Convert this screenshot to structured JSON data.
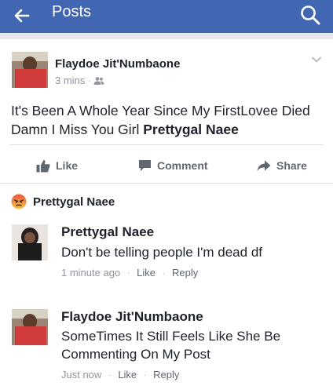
{
  "header": {
    "title": "Posts",
    "back_icon": "arrow-left-icon",
    "search_icon": "search-icon",
    "bar_color": "#4267b2"
  },
  "post": {
    "author": "Flaydoe Jit'Numbaone",
    "time": "3 mins",
    "dot": "·",
    "audience_icon": "friends-icon",
    "menu_icon": "chevron-down-icon",
    "text_prefix": "It's Been A Whole Year Since My FirstLovee Died Damn I Miss You Girl ",
    "tagged": "Prettygal Naee"
  },
  "actions": {
    "like": "Like",
    "comment": "Comment",
    "share": "Share"
  },
  "reaction": {
    "icon": "angry-reaction-icon",
    "name": "Prettygal Naee"
  },
  "comments": [
    {
      "name": "Prettygal Naee",
      "text": "Don't be telling people I'm dead df",
      "time": "1 minute ago",
      "like": "Like",
      "reply": "Reply",
      "dot": "·"
    },
    {
      "name": "Flaydoe Jit'Numbaone",
      "text": "SomeTimes It Still Feels Like She Be Commenting On My Post",
      "time": "Just now",
      "like": "Like",
      "reply": "Reply",
      "dot": "·"
    }
  ]
}
